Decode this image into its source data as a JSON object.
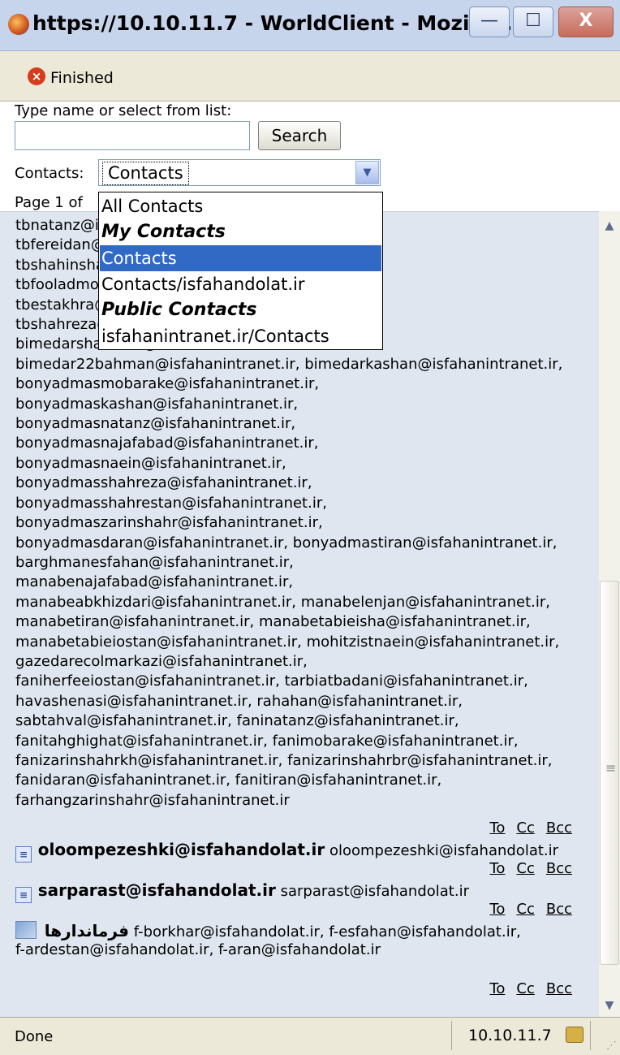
{
  "window": {
    "title": "https://10.10.11.7 - WorldClient - Mozilla...",
    "min_label": "—",
    "max_label": "☐",
    "close_label": "X"
  },
  "toolbar": {
    "status": "Finished"
  },
  "search": {
    "prompt": "Type name or select from list:",
    "value": "",
    "button": "Search"
  },
  "contacts": {
    "label": "Contacts:",
    "selected": "Contacts",
    "options": [
      {
        "label": "All Contacts",
        "group": false,
        "selected": false
      },
      {
        "label": "My Contacts",
        "group": true,
        "selected": false
      },
      {
        "label": "Contacts",
        "group": false,
        "selected": true
      },
      {
        "label": "Contacts/isfahandolat.ir",
        "group": false,
        "selected": false
      },
      {
        "label": "Public Contacts",
        "group": true,
        "selected": false
      },
      {
        "label": "isfahanintranet.ir/Contacts",
        "group": false,
        "selected": false
      }
    ]
  },
  "paging": {
    "text": "Page 1 of"
  },
  "email_lines": [
    "tbnatanz@isfahanintranet.ir,",
    "tbfereidan@isfahanintranet.ir,",
    "tbshahinshahr@isfahanintranet.ir,",
    "tbfooladmoran@isfahanintranet.ir,",
    "tbestakhra@isfahanintranet.ir,",
    "tbshahreza@isfahanintranet.ir,",
    "bimedarshahreza@isfahanintranet.ir,",
    "bimedar22bahman@isfahanintranet.ir, bimedarkashan@isfahanintranet.ir,",
    "bonyadmasmobarake@isfahanintranet.ir,",
    "bonyadmaskashan@isfahanintranet.ir,",
    "bonyadmasnatanz@isfahanintranet.ir,",
    "bonyadmasnajafabad@isfahanintranet.ir,",
    "bonyadmasnaein@isfahanintranet.ir,",
    "bonyadmasshahreza@isfahanintranet.ir,",
    "bonyadmasshahrestan@isfahanintranet.ir,",
    "bonyadmaszarinshahr@isfahanintranet.ir,",
    "bonyadmasdaran@isfahanintranet.ir, bonyadmastiran@isfahanintranet.ir,",
    "barghmanesfahan@isfahanintranet.ir,",
    "manabenajafabad@isfahanintranet.ir,",
    "manabeabkhizdari@isfahanintranet.ir, manabelenjan@isfahanintranet.ir,",
    "manabetiran@isfahanintranet.ir, manabetabieisha@isfahanintranet.ir,",
    "manabetabieiostan@isfahanintranet.ir, mohitzistnaein@isfahanintranet.ir,",
    "gazedarecolmarkazi@isfahanintranet.ir,",
    "faniherfeeiostan@isfahanintranet.ir, tarbiatbadani@isfahanintranet.ir,",
    "havashenasi@isfahanintranet.ir, rahahan@isfahanintranet.ir,",
    "sabtahval@isfahanintranet.ir, faninatanz@isfahanintranet.ir,",
    "fanitahghighat@isfahanintranet.ir, fanimobarake@isfahanintranet.ir,",
    "fanizarinshahrkh@isfahanintranet.ir, fanizarinshahrbr@isfahanintranet.ir,",
    "fanidaran@isfahanintranet.ir, fanitiran@isfahanintranet.ir,",
    "farhangzarinshahr@isfahanintranet.ir"
  ],
  "links": {
    "to": "To",
    "cc": "Cc",
    "bcc": "Bcc"
  },
  "entries": [
    {
      "name": "oloompezeshki@isfahandolat.ir",
      "email": "oloompezeshki@isfahandolat.ir"
    },
    {
      "name": "sarparast@isfahandolat.ir",
      "email": "sarparast@isfahandolat.ir"
    },
    {
      "name": "فرماندارها",
      "email": "f-borkhar@isfahandolat.ir, f-esfahan@isfahandolat.ir,",
      "email2": "f-ardestan@isfahandolat.ir, f-aran@isfahandolat.ir"
    }
  ],
  "statusbar": {
    "text": "Done",
    "host": "10.10.11.7"
  }
}
